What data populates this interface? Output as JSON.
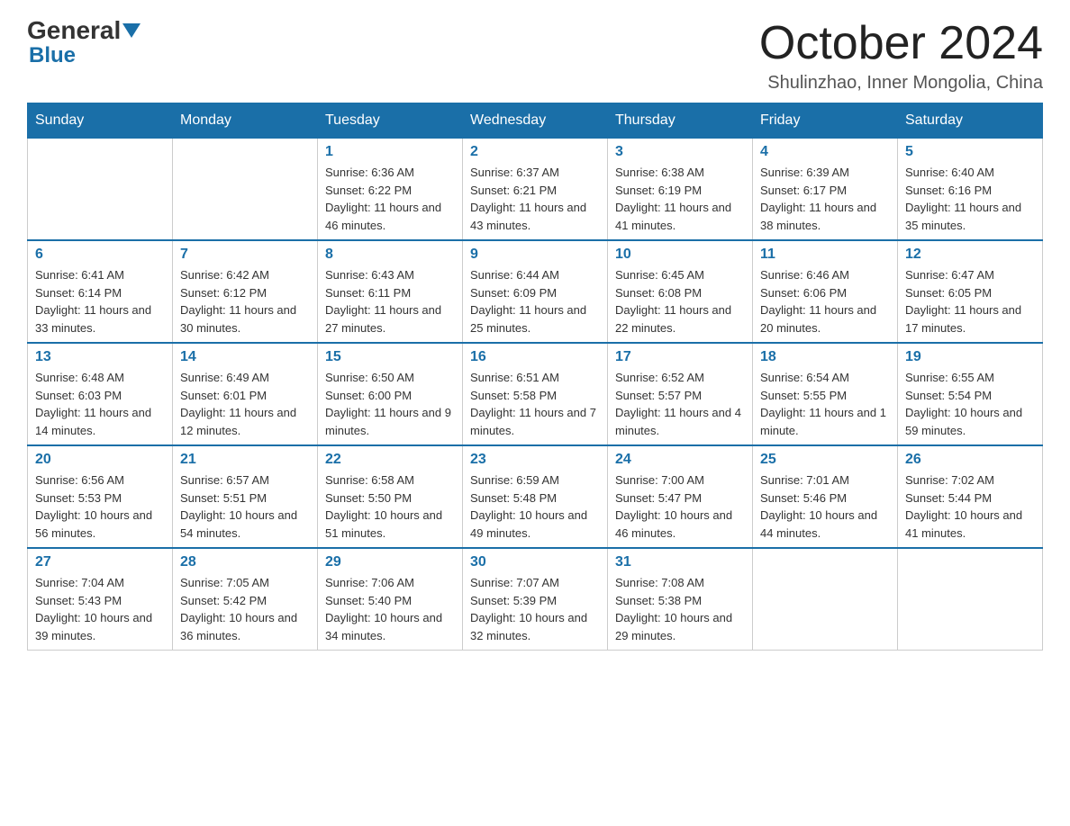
{
  "logo": {
    "general": "General",
    "blue": "Blue"
  },
  "title": "October 2024",
  "location": "Shulinzhao, Inner Mongolia, China",
  "weekdays": [
    "Sunday",
    "Monday",
    "Tuesday",
    "Wednesday",
    "Thursday",
    "Friday",
    "Saturday"
  ],
  "weeks": [
    [
      {
        "day": "",
        "sunrise": "",
        "sunset": "",
        "daylight": ""
      },
      {
        "day": "",
        "sunrise": "",
        "sunset": "",
        "daylight": ""
      },
      {
        "day": "1",
        "sunrise": "Sunrise: 6:36 AM",
        "sunset": "Sunset: 6:22 PM",
        "daylight": "Daylight: 11 hours and 46 minutes."
      },
      {
        "day": "2",
        "sunrise": "Sunrise: 6:37 AM",
        "sunset": "Sunset: 6:21 PM",
        "daylight": "Daylight: 11 hours and 43 minutes."
      },
      {
        "day": "3",
        "sunrise": "Sunrise: 6:38 AM",
        "sunset": "Sunset: 6:19 PM",
        "daylight": "Daylight: 11 hours and 41 minutes."
      },
      {
        "day": "4",
        "sunrise": "Sunrise: 6:39 AM",
        "sunset": "Sunset: 6:17 PM",
        "daylight": "Daylight: 11 hours and 38 minutes."
      },
      {
        "day": "5",
        "sunrise": "Sunrise: 6:40 AM",
        "sunset": "Sunset: 6:16 PM",
        "daylight": "Daylight: 11 hours and 35 minutes."
      }
    ],
    [
      {
        "day": "6",
        "sunrise": "Sunrise: 6:41 AM",
        "sunset": "Sunset: 6:14 PM",
        "daylight": "Daylight: 11 hours and 33 minutes."
      },
      {
        "day": "7",
        "sunrise": "Sunrise: 6:42 AM",
        "sunset": "Sunset: 6:12 PM",
        "daylight": "Daylight: 11 hours and 30 minutes."
      },
      {
        "day": "8",
        "sunrise": "Sunrise: 6:43 AM",
        "sunset": "Sunset: 6:11 PM",
        "daylight": "Daylight: 11 hours and 27 minutes."
      },
      {
        "day": "9",
        "sunrise": "Sunrise: 6:44 AM",
        "sunset": "Sunset: 6:09 PM",
        "daylight": "Daylight: 11 hours and 25 minutes."
      },
      {
        "day": "10",
        "sunrise": "Sunrise: 6:45 AM",
        "sunset": "Sunset: 6:08 PM",
        "daylight": "Daylight: 11 hours and 22 minutes."
      },
      {
        "day": "11",
        "sunrise": "Sunrise: 6:46 AM",
        "sunset": "Sunset: 6:06 PM",
        "daylight": "Daylight: 11 hours and 20 minutes."
      },
      {
        "day": "12",
        "sunrise": "Sunrise: 6:47 AM",
        "sunset": "Sunset: 6:05 PM",
        "daylight": "Daylight: 11 hours and 17 minutes."
      }
    ],
    [
      {
        "day": "13",
        "sunrise": "Sunrise: 6:48 AM",
        "sunset": "Sunset: 6:03 PM",
        "daylight": "Daylight: 11 hours and 14 minutes."
      },
      {
        "day": "14",
        "sunrise": "Sunrise: 6:49 AM",
        "sunset": "Sunset: 6:01 PM",
        "daylight": "Daylight: 11 hours and 12 minutes."
      },
      {
        "day": "15",
        "sunrise": "Sunrise: 6:50 AM",
        "sunset": "Sunset: 6:00 PM",
        "daylight": "Daylight: 11 hours and 9 minutes."
      },
      {
        "day": "16",
        "sunrise": "Sunrise: 6:51 AM",
        "sunset": "Sunset: 5:58 PM",
        "daylight": "Daylight: 11 hours and 7 minutes."
      },
      {
        "day": "17",
        "sunrise": "Sunrise: 6:52 AM",
        "sunset": "Sunset: 5:57 PM",
        "daylight": "Daylight: 11 hours and 4 minutes."
      },
      {
        "day": "18",
        "sunrise": "Sunrise: 6:54 AM",
        "sunset": "Sunset: 5:55 PM",
        "daylight": "Daylight: 11 hours and 1 minute."
      },
      {
        "day": "19",
        "sunrise": "Sunrise: 6:55 AM",
        "sunset": "Sunset: 5:54 PM",
        "daylight": "Daylight: 10 hours and 59 minutes."
      }
    ],
    [
      {
        "day": "20",
        "sunrise": "Sunrise: 6:56 AM",
        "sunset": "Sunset: 5:53 PM",
        "daylight": "Daylight: 10 hours and 56 minutes."
      },
      {
        "day": "21",
        "sunrise": "Sunrise: 6:57 AM",
        "sunset": "Sunset: 5:51 PM",
        "daylight": "Daylight: 10 hours and 54 minutes."
      },
      {
        "day": "22",
        "sunrise": "Sunrise: 6:58 AM",
        "sunset": "Sunset: 5:50 PM",
        "daylight": "Daylight: 10 hours and 51 minutes."
      },
      {
        "day": "23",
        "sunrise": "Sunrise: 6:59 AM",
        "sunset": "Sunset: 5:48 PM",
        "daylight": "Daylight: 10 hours and 49 minutes."
      },
      {
        "day": "24",
        "sunrise": "Sunrise: 7:00 AM",
        "sunset": "Sunset: 5:47 PM",
        "daylight": "Daylight: 10 hours and 46 minutes."
      },
      {
        "day": "25",
        "sunrise": "Sunrise: 7:01 AM",
        "sunset": "Sunset: 5:46 PM",
        "daylight": "Daylight: 10 hours and 44 minutes."
      },
      {
        "day": "26",
        "sunrise": "Sunrise: 7:02 AM",
        "sunset": "Sunset: 5:44 PM",
        "daylight": "Daylight: 10 hours and 41 minutes."
      }
    ],
    [
      {
        "day": "27",
        "sunrise": "Sunrise: 7:04 AM",
        "sunset": "Sunset: 5:43 PM",
        "daylight": "Daylight: 10 hours and 39 minutes."
      },
      {
        "day": "28",
        "sunrise": "Sunrise: 7:05 AM",
        "sunset": "Sunset: 5:42 PM",
        "daylight": "Daylight: 10 hours and 36 minutes."
      },
      {
        "day": "29",
        "sunrise": "Sunrise: 7:06 AM",
        "sunset": "Sunset: 5:40 PM",
        "daylight": "Daylight: 10 hours and 34 minutes."
      },
      {
        "day": "30",
        "sunrise": "Sunrise: 7:07 AM",
        "sunset": "Sunset: 5:39 PM",
        "daylight": "Daylight: 10 hours and 32 minutes."
      },
      {
        "day": "31",
        "sunrise": "Sunrise: 7:08 AM",
        "sunset": "Sunset: 5:38 PM",
        "daylight": "Daylight: 10 hours and 29 minutes."
      },
      {
        "day": "",
        "sunrise": "",
        "sunset": "",
        "daylight": ""
      },
      {
        "day": "",
        "sunrise": "",
        "sunset": "",
        "daylight": ""
      }
    ]
  ]
}
